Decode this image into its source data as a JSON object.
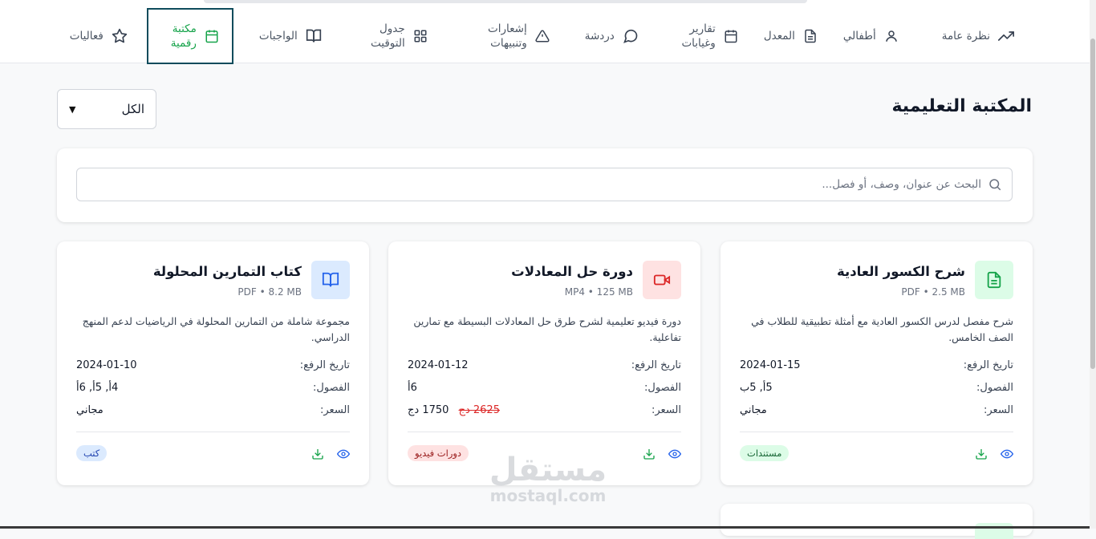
{
  "nav": {
    "items": [
      {
        "id": "overview",
        "label": "نظرة عامة",
        "icon": "trending-up-icon"
      },
      {
        "id": "children",
        "label": "أطفالي",
        "icon": "user-icon"
      },
      {
        "id": "grades",
        "label": "المعدل",
        "icon": "file-text-icon"
      },
      {
        "id": "reports",
        "label": "تقارير وغيابات",
        "icon": "calendar-icon"
      },
      {
        "id": "chat",
        "label": "دردشة",
        "icon": "chat-bubble-icon"
      },
      {
        "id": "alerts",
        "label": "إشعارات وتنبيهات",
        "icon": "alert-triangle-icon"
      },
      {
        "id": "schedule",
        "label": "جدول التوقيت",
        "icon": "grid-icon"
      },
      {
        "id": "homework",
        "label": "الواجبات",
        "icon": "book-open-icon"
      },
      {
        "id": "library",
        "label": "مكتبة رقمية",
        "icon": "calendar-icon",
        "active": true
      },
      {
        "id": "activities",
        "label": "فعاليات",
        "icon": "star-icon"
      }
    ]
  },
  "page": {
    "title": "المكتبة التعليمية",
    "filter": {
      "selected": "الكل"
    },
    "search_placeholder": "البحث عن عنوان، وصف، أو فصل..."
  },
  "labels": {
    "upload_date": "تاريخ الرفع:",
    "classes": "الفصول:",
    "price": "السعر:"
  },
  "cards": [
    {
      "title": "شرح الكسور العادية",
      "meta": "PDF • 2.5 MB",
      "description": "شرح مفصل لدرس الكسور العادية مع أمثلة تطبيقية للطلاب في الصف الخامس.",
      "date": "2024-01-15",
      "classes": "5أ, 5ب",
      "price": "مجاني",
      "badge": "مستندات",
      "icon": "document-icon"
    },
    {
      "title": "دورة حل المعادلات",
      "meta": "MP4 • 125 MB",
      "description": "دورة فيديو تعليمية لشرح طرق حل المعادلات البسيطة مع تمارين تفاعلية.",
      "date": "2024-01-12",
      "classes": "6أ",
      "price": "1750 دج",
      "price_old": "2625 دج",
      "badge": "دورات فيديو",
      "icon": "video-icon"
    },
    {
      "title": "كتاب التمارين المحلولة",
      "meta": "PDF • 8.2 MB",
      "description": "مجموعة شاملة من التمارين المحلولة في الرياضيات لدعم المنهج الدراسي.",
      "date": "2024-01-10",
      "classes": "4أ, 5أ, 6أ",
      "price": "مجاني",
      "badge": "كتب",
      "icon": "book-icon"
    }
  ],
  "colors": {
    "green": "#16a34a",
    "blue": "#2563eb",
    "red": "#dc2626",
    "badge_docs_bg": "#dcfce7",
    "badge_video_bg": "#fee2e2",
    "badge_books_bg": "#dbeafe"
  }
}
